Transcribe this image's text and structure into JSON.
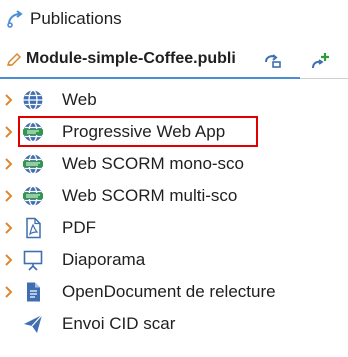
{
  "header": {
    "title": "Publications",
    "icon": "publications-icon"
  },
  "module": {
    "label": "Module-simple-Coffee.publi",
    "icon": "module-pencil-icon",
    "open_action_icon": "open-action-icon",
    "add_action_icon": "add-action-icon"
  },
  "tree": {
    "items": [
      {
        "label": "Web",
        "icon": "globe-icon",
        "expandable": true
      },
      {
        "label": "Progressive Web App",
        "icon": "pwa-globe-icon",
        "expandable": true,
        "selected": true
      },
      {
        "label": "Web SCORM mono-sco",
        "icon": "scorm-globe-icon",
        "expandable": true
      },
      {
        "label": "Web SCORM multi-sco",
        "icon": "scorm-globe-icon",
        "expandable": true
      },
      {
        "label": "PDF",
        "icon": "pdf-icon",
        "expandable": true
      },
      {
        "label": "Diaporama",
        "icon": "presentation-icon",
        "expandable": true
      },
      {
        "label": "OpenDocument de relecture",
        "icon": "document-icon",
        "expandable": true
      },
      {
        "label": "Envoi CID scar",
        "icon": "send-icon",
        "expandable": false
      }
    ]
  },
  "colors": {
    "accent": "#4a8fd6",
    "chevron": "#e0862d",
    "globe": "#3f6fb0",
    "green": "#2e9b3e",
    "selection_border": "#e00000"
  }
}
